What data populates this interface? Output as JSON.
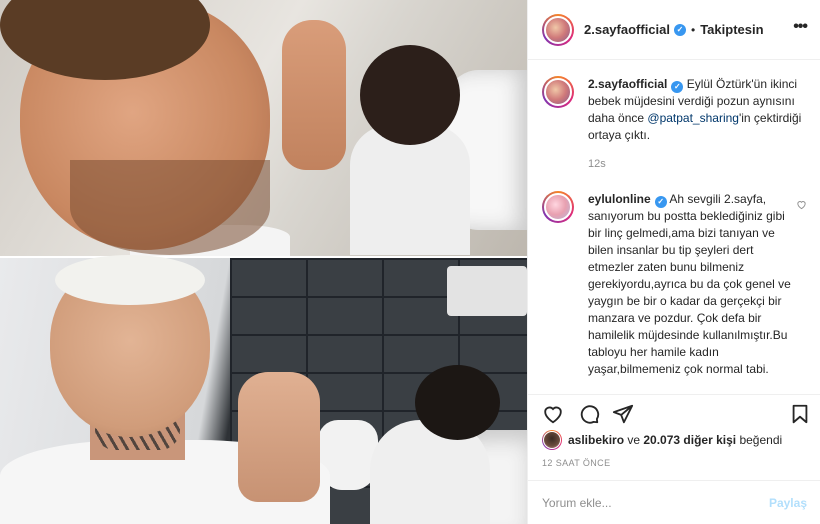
{
  "post": {
    "author": "2.sayfaofficial",
    "follow_status": "Takiptesin",
    "separator": "•",
    "more_icon": "more-horizontal-icon"
  },
  "comments": [
    {
      "user": "2.sayfaofficial",
      "text_before": " Eylül Öztürk'ün ikinci bebek müjdesini verdiği pozun aynısını daha önce ",
      "mention": "@patpat_sharing",
      "text_after": "'in çektirdiği ortaya çıktı.",
      "time": "12s"
    },
    {
      "user": "eylulonline",
      "text": " Ah sevgili 2.sayfa, sanıyorum bu postta beklediğiniz gibi bir linç gelmedi,ama bizi tanıyan ve bilen insanlar bu tip şeyleri dert etmezler zaten bunu bilmeniz gerekiyordu,ayrıca bu da çok genel ve yaygın be bir o kadar da gerçekçi bir manzara ve pozdur. Çok defa bir hamilelik müjdesinde kullanılmıştır.Bu tabloyu her hamile kadın yaşar,bilmemeniz çok normal tabi.",
      "like_icon": "heart-outline-icon"
    }
  ],
  "likes": {
    "user": "aslibekiro",
    "connector": " ve ",
    "count_text": "20.073 diğer kişi",
    "suffix": " beğendi"
  },
  "post_time": "12 SAAT ÖNCE",
  "composer": {
    "placeholder": "Yorum ekle...",
    "share_label": "Paylaş"
  },
  "verified_mark": "✓",
  "colors": {
    "accent": "#3897f0",
    "share_disabled": "#b2dffc",
    "link": "#00376b",
    "muted": "#8e8e8e"
  }
}
